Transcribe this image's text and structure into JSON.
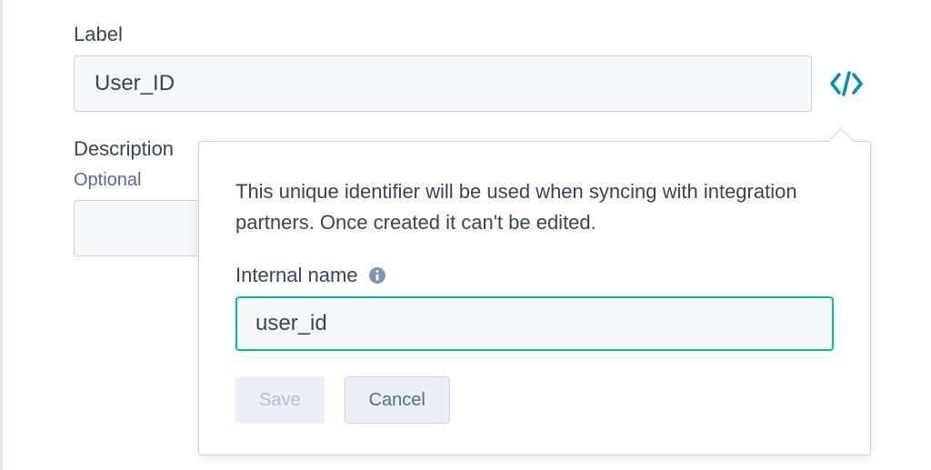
{
  "form": {
    "label": {
      "title": "Label",
      "value": "User_ID"
    },
    "description": {
      "title": "Description",
      "optional": "Optional",
      "value": ""
    }
  },
  "popover": {
    "text": "This unique identifier will be used when syncing with integration partners. Once created it can't be edited.",
    "internal_name": {
      "label": "Internal name",
      "value": "user_id"
    },
    "buttons": {
      "save": "Save",
      "cancel": "Cancel"
    }
  }
}
